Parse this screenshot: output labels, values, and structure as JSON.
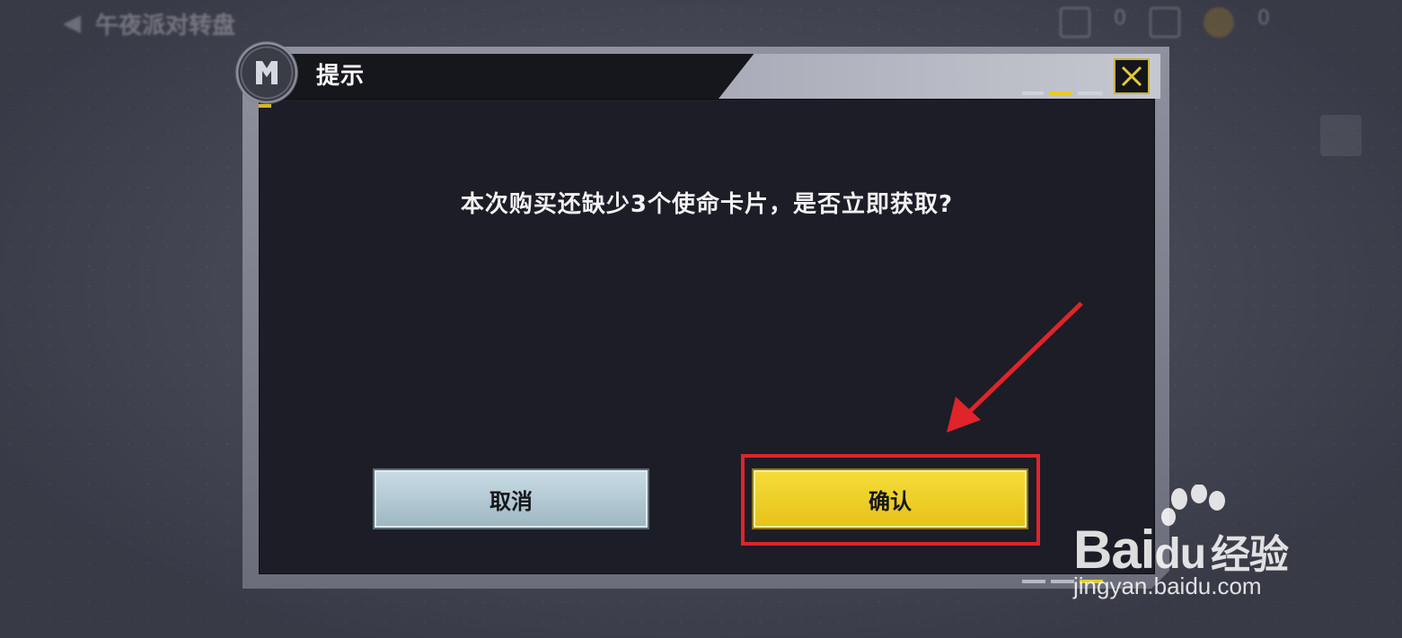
{
  "background": {
    "title": "午夜派对转盘",
    "currency_count_1": "0",
    "currency_count_2": "0"
  },
  "dialog": {
    "title": "提示",
    "message": "本次购买还缺少3个使命卡片，是否立即获取?",
    "cancel_label": "取消",
    "confirm_label": "确认",
    "close_icon": "close-icon",
    "emblem_icon": "game-logo-icon"
  },
  "watermark": {
    "brand_left": "Bai",
    "brand_mid": "du",
    "brand_right": "经验",
    "url": "jingyan.baidu.com"
  },
  "colors": {
    "accent_yellow": "#e7c21a",
    "highlight_red": "#e0242a",
    "cancel_blue": "#b5cbd5"
  }
}
